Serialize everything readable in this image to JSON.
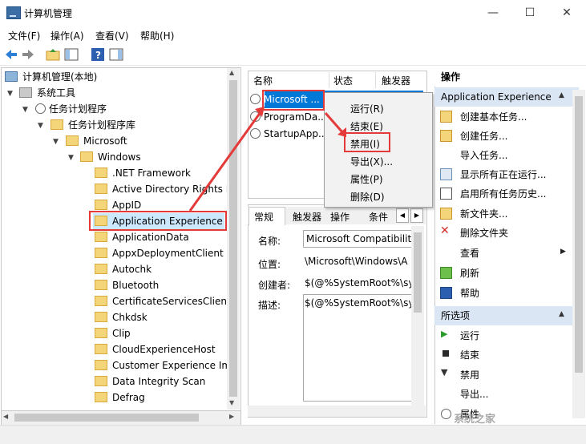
{
  "window": {
    "title": "计算机管理",
    "minimize": "—",
    "maximize": "☐",
    "close": "✕"
  },
  "menu": [
    "文件(F)",
    "操作(A)",
    "查看(V)",
    "帮助(H)"
  ],
  "tree": {
    "root": "计算机管理(本地)",
    "system_tools": "系统工具",
    "task_scheduler": "任务计划程序",
    "task_library": "任务计划程序库",
    "microsoft": "Microsoft",
    "windows": "Windows",
    "folders": [
      ".NET Framework",
      "Active Directory Rights M",
      "AppID",
      "Application Experience",
      "ApplicationData",
      "AppxDeploymentClient",
      "Autochk",
      "Bluetooth",
      "CertificateServicesClient",
      "Chkdsk",
      "Clip",
      "CloudExperienceHost",
      "Customer Experience Im",
      "Data Integrity Scan",
      "Defrag"
    ]
  },
  "tasklist": {
    "columns": {
      "name": "名称",
      "status": "状态",
      "trigger": "触发器"
    },
    "tasks": [
      "Microsoft ...",
      "ProgramDa...",
      "StartupApp..."
    ]
  },
  "context_menu": [
    "运行(R)",
    "结束(E)",
    "禁用(I)",
    "导出(X)...",
    "属性(P)",
    "删除(D)"
  ],
  "detail": {
    "tabs": [
      "常规",
      "触发器",
      "操作",
      "条件"
    ],
    "name_label": "名称:",
    "name_value": "Microsoft Compatibilit",
    "location_label": "位置:",
    "location_value": "\\Microsoft\\Windows\\A",
    "author_label": "创建者:",
    "author_value": "$(@%SystemRoot%\\sy",
    "desc_label": "描述:",
    "desc_value": "$(@%SystemRoot%\\sy"
  },
  "actions": {
    "header": "操作",
    "section1": "Application Experience",
    "items1": [
      "创建基本任务...",
      "创建任务...",
      "导入任务...",
      "显示所有正在运行...",
      "启用所有任务历史...",
      "新文件夹...",
      "删除文件夹",
      "查看",
      "刷新",
      "帮助"
    ],
    "section2": "所选项",
    "items2": [
      "运行",
      "结束",
      "禁用",
      "导出...",
      "属性"
    ]
  },
  "watermark": "系统之家",
  "colors": {
    "selection": "#0078d7",
    "highlight_box": "#e43a3a",
    "tree_selected": "#cce8ff",
    "action_header": "#dbe6f4"
  }
}
